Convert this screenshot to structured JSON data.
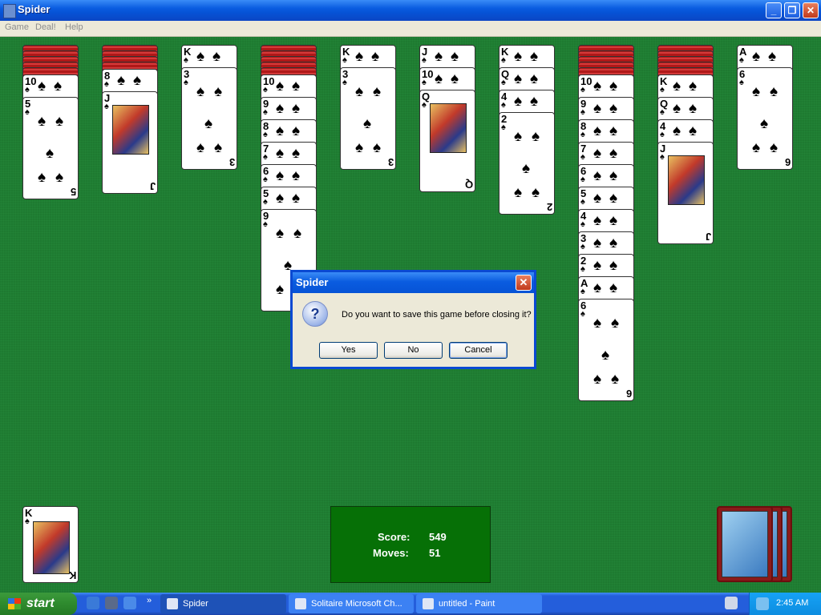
{
  "window": {
    "title": "Spider",
    "min_label": "_",
    "max_label": "❐",
    "close_label": "✕"
  },
  "menu": {
    "items": [
      "Game",
      "Deal!",
      "Help"
    ]
  },
  "suit": "♠",
  "tableau": [
    {
      "backs": 5,
      "cards": [
        "10",
        "5"
      ]
    },
    {
      "backs": 4,
      "cards": [
        "8",
        "J"
      ]
    },
    {
      "backs": 0,
      "cards": [
        "K",
        "3"
      ]
    },
    {
      "backs": 5,
      "cards": [
        "10",
        "9",
        "8",
        "7",
        "6",
        "5",
        "9"
      ]
    },
    {
      "backs": 0,
      "cards": [
        "K",
        "3"
      ]
    },
    {
      "backs": 0,
      "cards": [
        "J",
        "10",
        "Q"
      ]
    },
    {
      "backs": 0,
      "cards": [
        "K",
        "Q",
        "4",
        "2"
      ]
    },
    {
      "backs": 5,
      "cards": [
        "10",
        "9",
        "8",
        "7",
        "6",
        "5",
        "4",
        "3",
        "2",
        "A",
        "6"
      ]
    },
    {
      "backs": 5,
      "cards": [
        "K",
        "Q",
        "4",
        "J"
      ]
    },
    {
      "backs": 0,
      "cards": [
        "A",
        "6"
      ]
    }
  ],
  "completed": {
    "rank": "K"
  },
  "score": {
    "score_label": "Score:",
    "score_value": "549",
    "moves_label": "Moves:",
    "moves_value": "51"
  },
  "dialog": {
    "title": "Spider",
    "message": "Do you want to save this game before closing it?",
    "icon": "?",
    "close": "✕",
    "yes": "Yes",
    "no": "No",
    "cancel": "Cancel"
  },
  "taskbar": {
    "start": "start",
    "tasks": [
      "Spider",
      "Solitaire Microsoft Ch...",
      "untitled - Paint"
    ],
    "chevron": "»",
    "clock": "2:45 AM"
  }
}
